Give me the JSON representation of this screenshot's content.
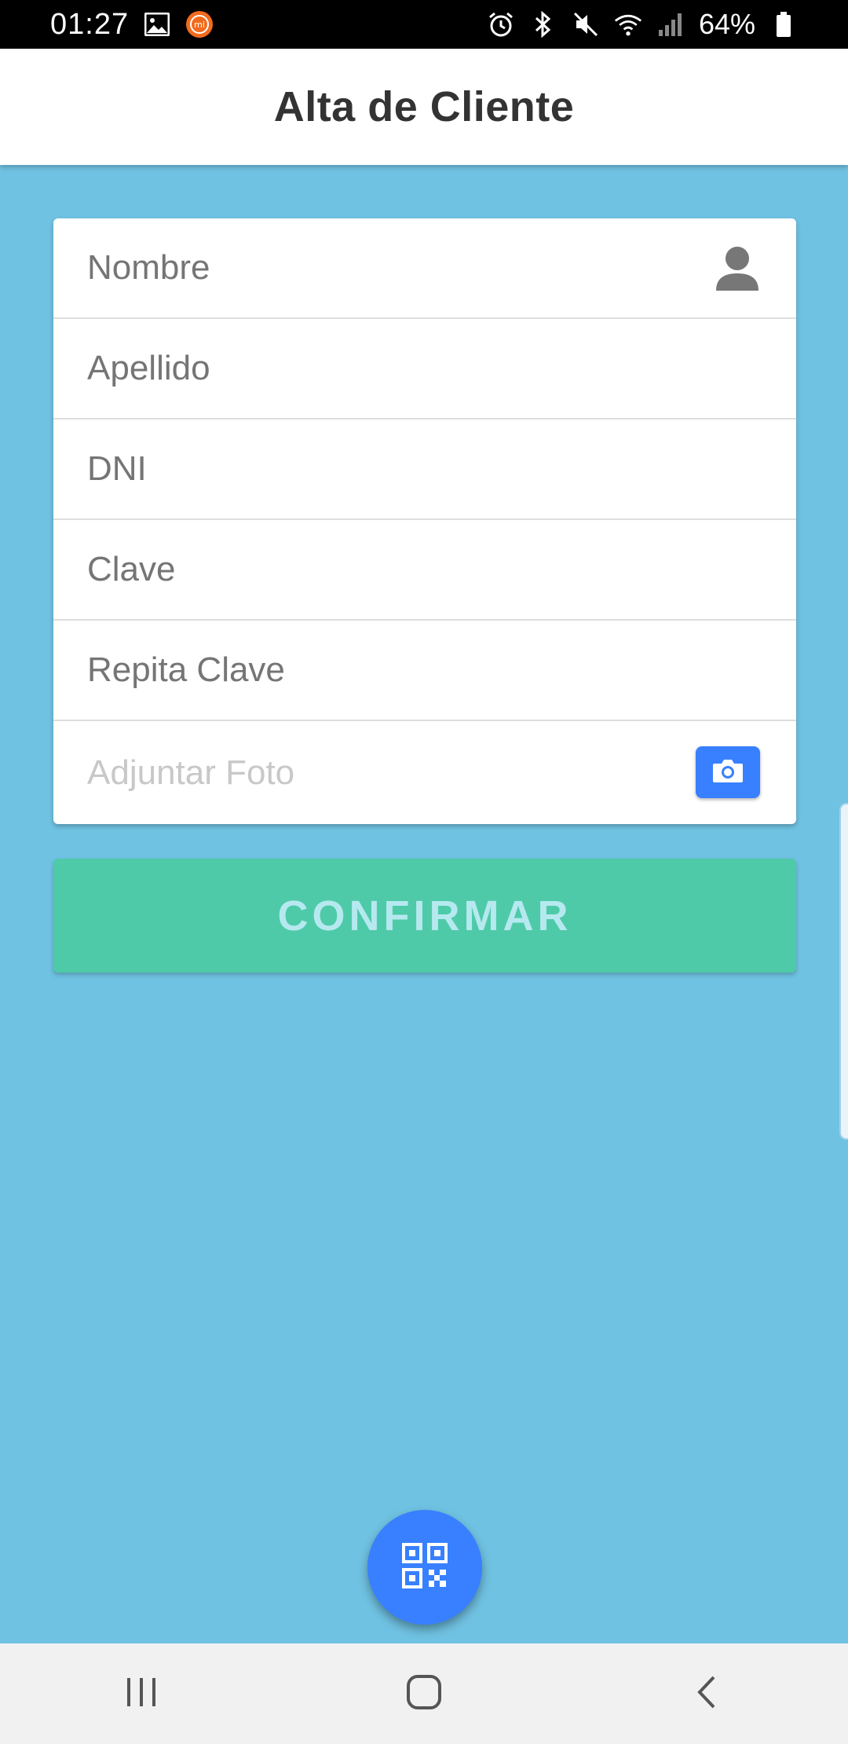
{
  "status_bar": {
    "time": "01:27",
    "battery_percent": "64%",
    "left_icons": [
      "gallery-icon",
      "mi-app-icon"
    ],
    "right_icons": [
      "alarm-icon",
      "bluetooth-icon",
      "mute-icon",
      "wifi-icon",
      "signal-icon",
      "battery-icon"
    ]
  },
  "header": {
    "title": "Alta de Cliente"
  },
  "form": {
    "fields": [
      {
        "placeholder": "Nombre",
        "icon": "person-icon"
      },
      {
        "placeholder": "Apellido"
      },
      {
        "placeholder": "DNI"
      },
      {
        "placeholder": "Clave"
      },
      {
        "placeholder": "Repita Clave"
      },
      {
        "placeholder": "Adjuntar Foto",
        "icon": "camera-icon"
      }
    ]
  },
  "confirm_button": {
    "label": "CONFIRMAR"
  },
  "fab": {
    "icon": "qr-code-icon"
  },
  "nav_bar": {
    "buttons": [
      "recent-apps-icon",
      "home-icon",
      "back-icon"
    ]
  },
  "colors": {
    "background": "#70c2e2",
    "header": "#ffffff",
    "primary": "#3880ff",
    "confirm": "#4fcaa9",
    "confirm_text": "#b6e9ef"
  }
}
